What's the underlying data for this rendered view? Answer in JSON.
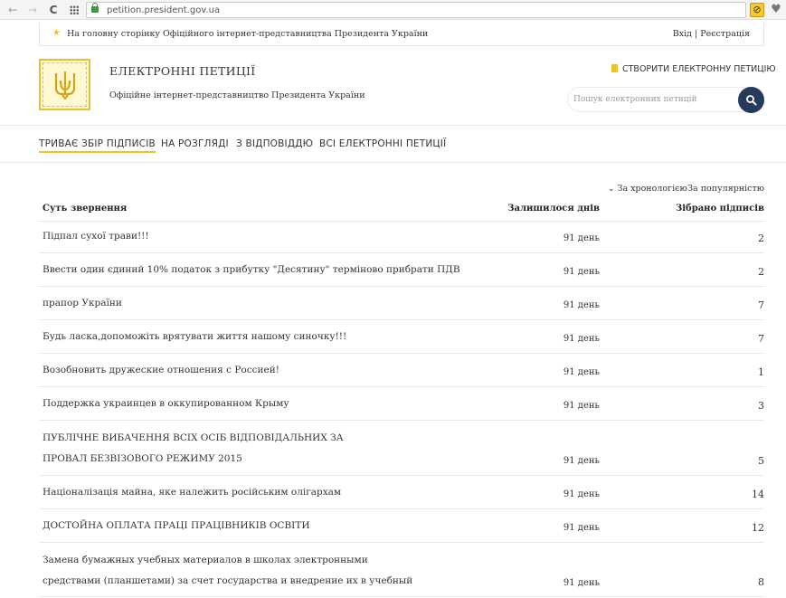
{
  "browser": {
    "url": "petition.president.gov.ua",
    "back_icon": "←",
    "forward_icon": "→",
    "reload_icon": "C",
    "ext_icon": "⊘",
    "heart_icon": "♥"
  },
  "infobar": {
    "home_link": "На головну сторінку Офіційного інтернет-представництва Президента України",
    "auth": "Вхід | Реєстрація",
    "star_icon": "★"
  },
  "header": {
    "title": "ЕЛЕКТРОННІ ПЕТИЦІЇ",
    "subtitle": "Офіційне інтернет-представництво Президента України",
    "create_label": "СТВОРИТИ ЕЛЕКТРОННУ ПЕТИЦІЮ",
    "search_placeholder": "Пошук електронних петицій"
  },
  "tabs": [
    {
      "label": "ТРИВАЄ ЗБІР ПІДПИСІВ",
      "active": true
    },
    {
      "label": "НА РОЗГЛЯДІ"
    },
    {
      "label": "З ВІДПОВІДДЮ"
    },
    {
      "label": "ВСІ ЕЛЕКТРОННІ ПЕТИЦІЇ"
    }
  ],
  "sort": {
    "chevron": "⌄",
    "by_chronology": "За хронологією",
    "by_popularity": "За популярністю"
  },
  "table": {
    "columns": [
      "Суть звернення",
      "Залишилося днів",
      "Зібрано підписів"
    ],
    "rows": [
      {
        "title": "Підпал сухої трави!!!",
        "days": "91 день",
        "votes": "2"
      },
      {
        "title": "Ввести один єдиний 10% податок з прибутку \"Десятину\" терміново прибрати ПДВ",
        "days": "91 день",
        "votes": "2"
      },
      {
        "title": "прапор України",
        "days": "91 день",
        "votes": "7"
      },
      {
        "title": "Будь ласка,допоможіть врятувати життя нашому синочку!!!",
        "days": "91 день",
        "votes": "7"
      },
      {
        "title": "Возобновить дружеские отношения с Россией!",
        "days": "91 день",
        "votes": "1"
      },
      {
        "title": "Поддержка украинцев в оккупированном Крыму",
        "days": "91 день",
        "votes": "3"
      },
      {
        "title": "ПУБЛІЧНЕ ВИБАЧЕННЯ ВСІХ ОСІБ ВІДПОВІДАЛЬНИХ ЗА ПРОВАЛ БЕЗВІЗОВОГО РЕЖИМУ 2015",
        "days": "91 день",
        "votes": "5"
      },
      {
        "title": "Націоналізація майна, яке належить російським олігархам",
        "days": "91 день",
        "votes": "14"
      },
      {
        "title": "ДОСТОЙНА ОПЛАТА ПРАЦІ ПРАЦІВНИКІВ ОСВІТИ",
        "days": "91 день",
        "votes": "12"
      },
      {
        "title": "Замена бумажных учебных материалов в школах электронными средствами (планшетами) за счет государства и внедрение их в учебный процесс.",
        "days": "91 день",
        "votes": "8"
      }
    ]
  }
}
